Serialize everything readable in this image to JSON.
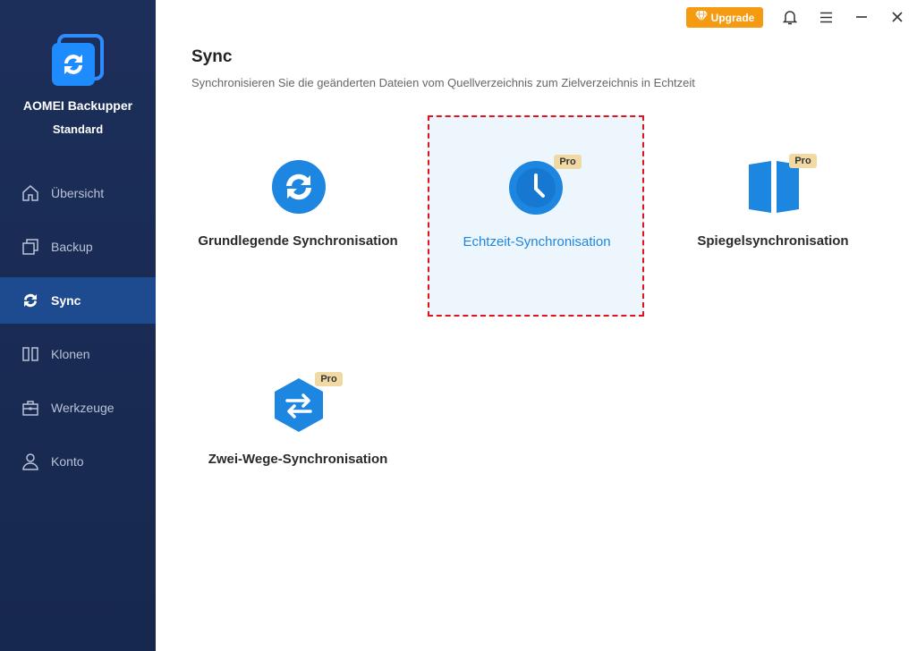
{
  "app": {
    "name": "AOMEI Backupper",
    "edition": "Standard"
  },
  "sidebar": {
    "items": [
      {
        "label": "Übersicht",
        "icon": "home-icon"
      },
      {
        "label": "Backup",
        "icon": "copy-icon"
      },
      {
        "label": "Sync",
        "icon": "sync-icon",
        "active": true
      },
      {
        "label": "Klonen",
        "icon": "clone-icon"
      },
      {
        "label": "Werkzeuge",
        "icon": "toolbox-icon"
      },
      {
        "label": "Konto",
        "icon": "user-icon"
      }
    ]
  },
  "topbar": {
    "upgrade_label": "Upgrade"
  },
  "page": {
    "title": "Sync",
    "subtitle": "Synchronisieren Sie die geänderten Dateien vom Quellverzeichnis zum Zielverzeichnis in Echtzeit"
  },
  "options": [
    {
      "label": "Grundlegende Synchronisation",
      "pro": ""
    },
    {
      "label": "Echtzeit-Synchronisation",
      "pro": "Pro",
      "selected": true
    },
    {
      "label": "Spiegelsynchronisation",
      "pro": "Pro"
    },
    {
      "label": "Zwei-Wege-Synchronisation",
      "pro": "Pro"
    }
  ],
  "colors": {
    "sidebar_bg": "#1c2f5a",
    "sidebar_active": "#1e4b8f",
    "accent_blue": "#1d86e0",
    "upgrade_orange": "#f49b12",
    "selection_border": "#e0141e",
    "pro_badge": "#f1d9a4"
  }
}
